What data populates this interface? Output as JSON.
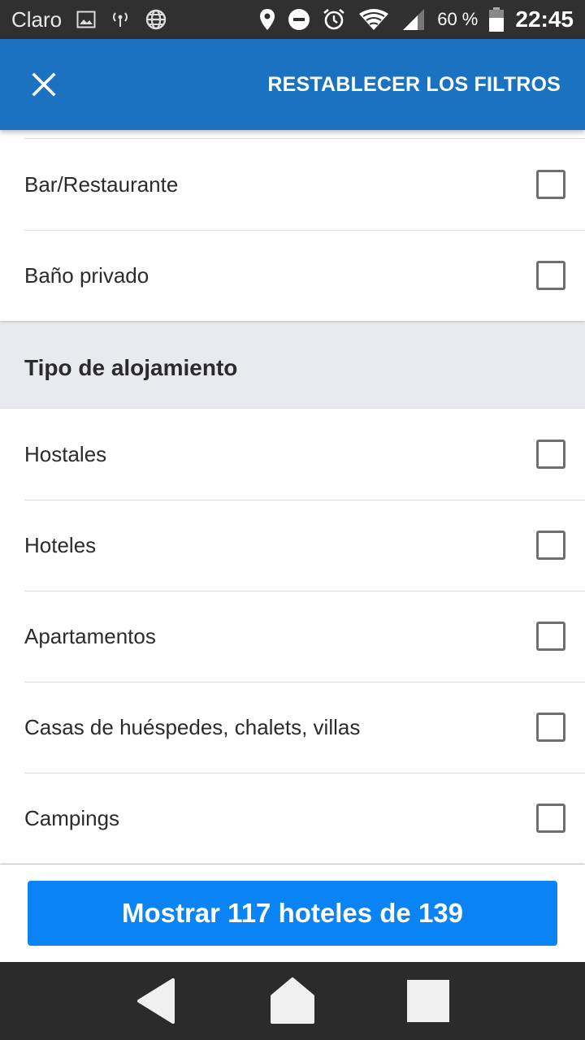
{
  "status_bar": {
    "carrier": "Claro",
    "battery_percent": "60 %",
    "time": "22:45",
    "icons": [
      "image-icon",
      "hotspot-icon",
      "globe-icon",
      "location-icon",
      "dnd-icon",
      "alarm-icon",
      "wifi-icon",
      "signal-icon",
      "battery-icon"
    ]
  },
  "app_bar": {
    "close_icon": "close-icon",
    "reset_label": "RESTABLECER LOS FILTROS",
    "background": "#1b72c0"
  },
  "facilities": {
    "items": [
      {
        "label": "Bar/Restaurante",
        "checked": false
      },
      {
        "label": "Baño privado",
        "checked": false
      }
    ]
  },
  "accommodation_type": {
    "title": "Tipo de alojamiento",
    "items": [
      {
        "label": "Hostales",
        "checked": false
      },
      {
        "label": "Hoteles",
        "checked": false
      },
      {
        "label": "Apartamentos",
        "checked": false
      },
      {
        "label": "Casas de huéspedes, chalets, villas",
        "checked": false
      },
      {
        "label": "Campings",
        "checked": false
      }
    ]
  },
  "footer": {
    "show_button_label": "Mostrar 117 hoteles de 139",
    "button_color": "#0a84f5"
  },
  "nav_bar": {
    "icons": [
      "back-icon",
      "home-icon",
      "recents-icon"
    ]
  }
}
